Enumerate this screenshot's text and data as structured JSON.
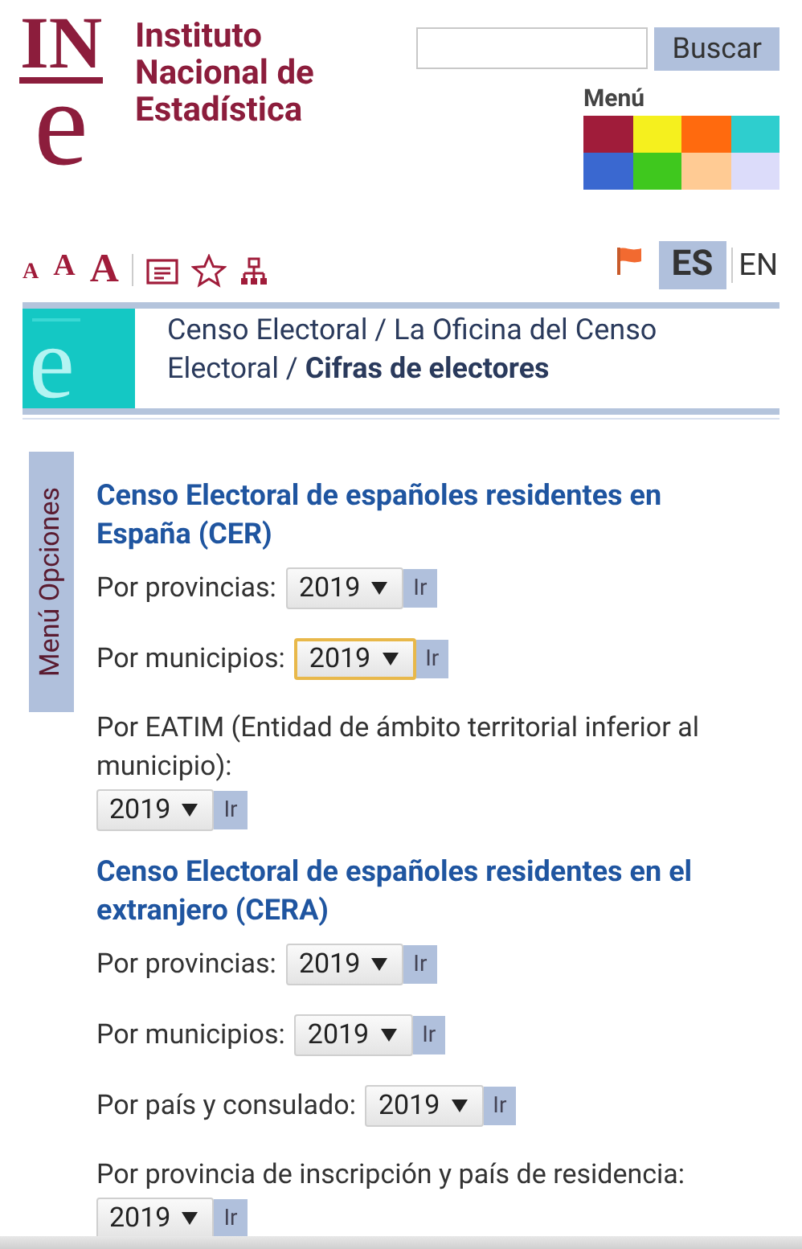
{
  "header": {
    "logo_top": "IN",
    "logo_bottom": "e",
    "org_name": "Instituto Nacional de Estadística",
    "search_button": "Buscar",
    "menu_label": "Menú",
    "menu_colors": [
      {
        "color": "#a01c3a"
      },
      {
        "color": "#f5f01e"
      },
      {
        "color": "#ff6a0e"
      },
      {
        "color": "#2ecece"
      },
      {
        "color": "#3a68d0"
      },
      {
        "color": "#3fc81e"
      },
      {
        "color": "#ffcb94"
      },
      {
        "color": "#dcdcfa"
      }
    ]
  },
  "toolbar": {
    "font_sizes": [
      "A",
      "A",
      "A"
    ],
    "languages": [
      {
        "label": "ES",
        "selected": true
      },
      {
        "label": "EN",
        "selected": false
      }
    ]
  },
  "breadcrumb": {
    "emblem": "e",
    "text": "Censo Electoral / La Oficina del Censo Electoral / **Cifras de electores**"
  },
  "side_tab": "Menú Opciones",
  "sections": [
    {
      "title": "Censo Electoral de españoles residentes en España (CER)",
      "rows": [
        {
          "label": "Por provincias:",
          "year": "2019",
          "button": "Ir",
          "focused": false
        },
        {
          "label": "Por municipios:",
          "year": "2019",
          "button": "Ir",
          "focused": true
        },
        {
          "label": "Por EATIM (Entidad de ámbito territorial inferior al municipio):",
          "year": "2019",
          "button": "Ir",
          "focused": false
        }
      ]
    },
    {
      "title": "Censo Electoral de españoles residentes en el extranjero (CERA)",
      "rows": [
        {
          "label": "Por provincias:",
          "year": "2019",
          "button": "Ir",
          "focused": false
        },
        {
          "label": "Por municipios:",
          "year": "2019",
          "button": "Ir",
          "focused": false
        },
        {
          "label": "Por país y consulado:",
          "year": "2019",
          "button": "Ir",
          "focused": false
        },
        {
          "label": "Por provincia de inscripción y país de residencia:",
          "year": "2019",
          "button": "Ir",
          "focused": false
        }
      ]
    }
  ]
}
